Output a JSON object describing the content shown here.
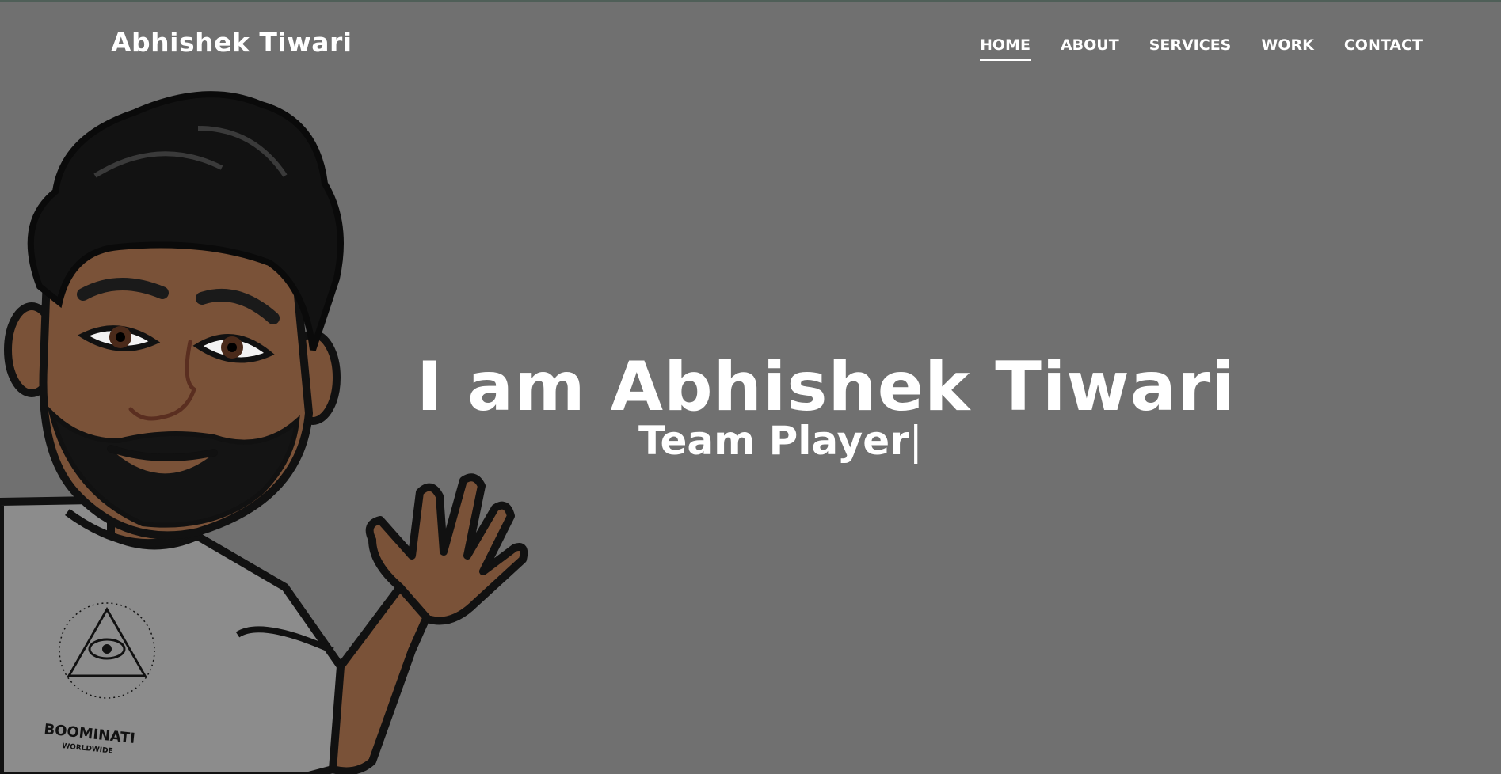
{
  "navbar": {
    "brand": "Abhishek Tiwari",
    "links": [
      {
        "label": "HOME",
        "active": true
      },
      {
        "label": "ABOUT",
        "active": false
      },
      {
        "label": "SERVICES",
        "active": false
      },
      {
        "label": "WORK",
        "active": false
      },
      {
        "label": "CONTACT",
        "active": false
      }
    ]
  },
  "hero": {
    "title": "I am Abhishek Tiwari",
    "typed_text": "Team Player",
    "cursor": "|"
  },
  "avatar": {
    "icon": "bitmoji-avatar-waving",
    "shirt_logo_line1": "BOOMINATI",
    "shirt_logo_line2": "WORLDWIDE"
  },
  "colors": {
    "background": "#707070",
    "text": "#ffffff",
    "skin": "#7a5238",
    "hair": "#111111",
    "shirt": "#8a8a8a"
  }
}
